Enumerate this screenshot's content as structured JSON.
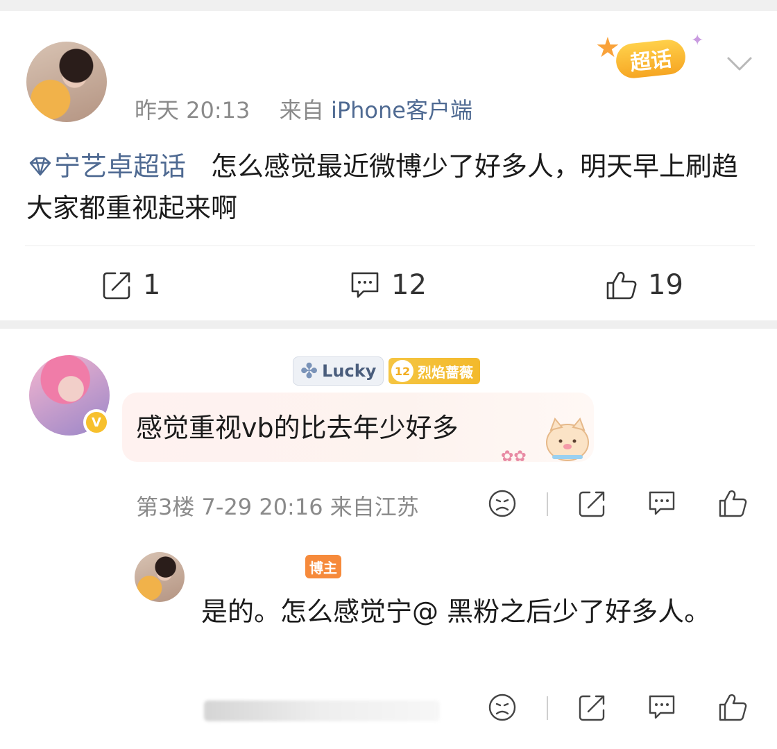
{
  "post": {
    "timestamp": "昨天 20:13",
    "source_prefix": "来自",
    "source": "iPhone客户端",
    "chaohua_badge": "超话",
    "topic_tag": "宁艺卓超话",
    "text": "怎么感觉最近微博少了好多人，明天早上刷趋大家都重视起来啊",
    "actions": {
      "share_count": "1",
      "comment_count": "12",
      "like_count": "19"
    }
  },
  "comment": {
    "badge_lucky": "Lucky",
    "fan_level": "12",
    "fan_group": "烈焰蔷薇",
    "verified_mark": "V",
    "text": "感觉重视vb的比去年少好多",
    "meta": "第3楼 7-29 20:16 来自江苏"
  },
  "reply": {
    "blogger_badge": "博主",
    "text": "是的。怎么感觉宁@ 黑粉之后少了好多人。"
  },
  "icons": {
    "share": "share-icon",
    "comment": "comment-icon",
    "like": "thumbs-up-icon",
    "dislike": "sad-face-icon",
    "chevron": "chevron-down-icon"
  },
  "colors": {
    "link": "#4f6a92",
    "meta": "#8a8a8a",
    "badge_orange": "#f68a3b",
    "fan_gold": "#f3b92b"
  }
}
